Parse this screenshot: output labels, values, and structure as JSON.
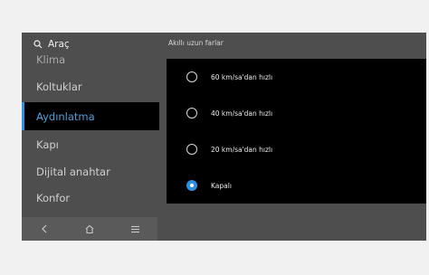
{
  "search": {
    "label": "Araç"
  },
  "sidebar": {
    "items": [
      {
        "label": "Klima"
      },
      {
        "label": "Koltuklar"
      },
      {
        "label": "Aydınlatma"
      },
      {
        "label": "Kapı"
      },
      {
        "label": "Dijital anahtar"
      },
      {
        "label": "Konfor"
      }
    ],
    "active_index": 2
  },
  "nav": {
    "back": "back-icon",
    "home": "home-icon",
    "menu": "menu-icon"
  },
  "panel": {
    "title": "Akıllı uzun farlar",
    "options": [
      {
        "label": "60 km/sa'dan hızlı",
        "selected": false
      },
      {
        "label": "40 km/sa'dan hızlı",
        "selected": false
      },
      {
        "label": "20 km/sa'dan hızlı",
        "selected": false
      },
      {
        "label": "Kapalı",
        "selected": true
      }
    ]
  },
  "colors": {
    "accent": "#2f8fe0",
    "background": "#4e4e4e",
    "panel": "#000000"
  }
}
